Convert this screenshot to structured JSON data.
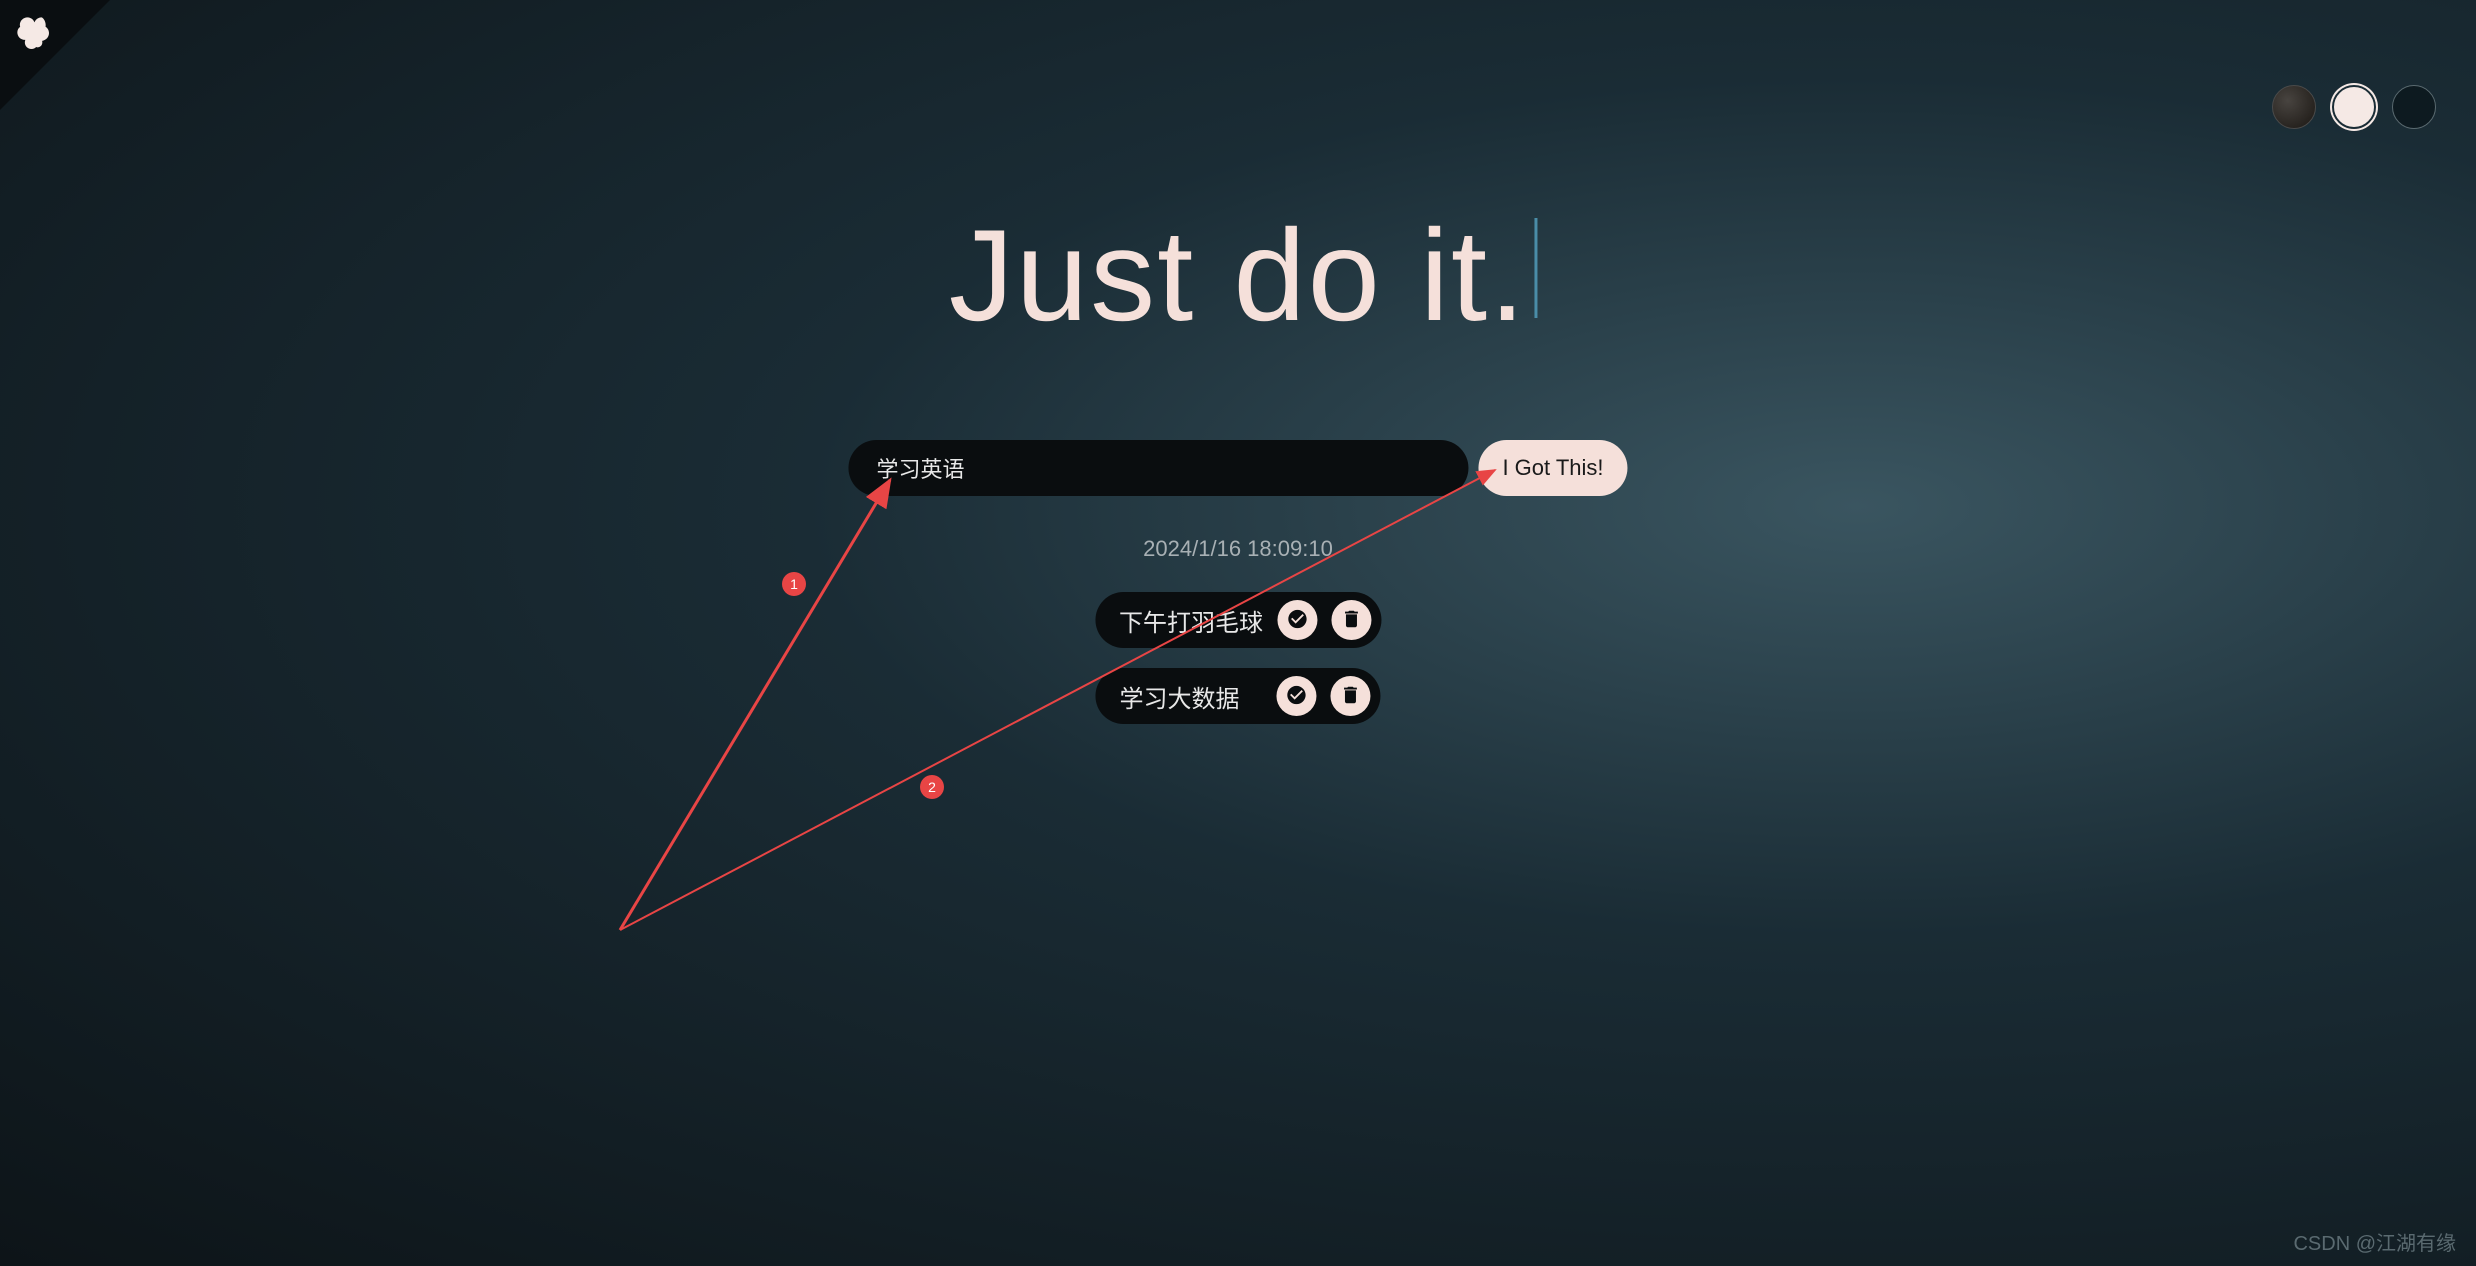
{
  "title": "Just do it.",
  "input": {
    "value": "学习英语",
    "submit_label": "I Got This!"
  },
  "timestamp": "2024/1/16 18:09:10",
  "tasks": [
    {
      "text": "下午打羽毛球"
    },
    {
      "text": "学习大数据"
    }
  ],
  "theme_swatches": [
    {
      "name": "dark-warm"
    },
    {
      "name": "light"
    },
    {
      "name": "dark-teal"
    }
  ],
  "annotations": {
    "badge1": "1",
    "badge2": "2"
  },
  "watermark": "CSDN @江湖有缘"
}
